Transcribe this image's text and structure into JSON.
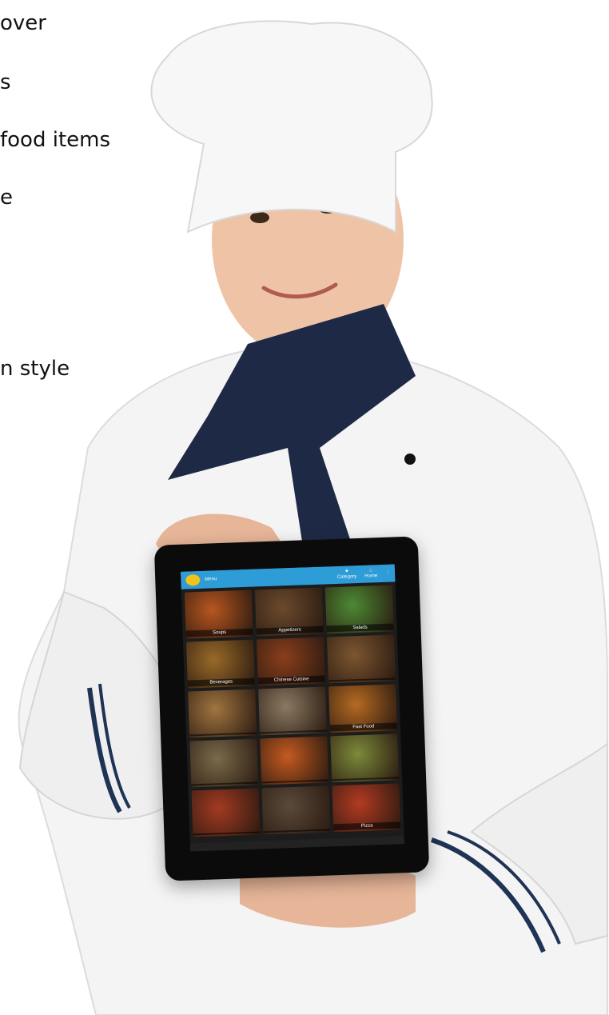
{
  "slide_text": {
    "line1": "over",
    "line2": "s",
    "line3": "food items",
    "line4": "e",
    "line5": "n style"
  },
  "app": {
    "title": "Menu",
    "action_1": "Category",
    "action_2": "Home",
    "footer_left": "",
    "footer_right": ""
  },
  "menu_tiles": [
    {
      "label": "Soups",
      "color": "#b8561f"
    },
    {
      "label": "Appetizers",
      "color": "#6b4a2d"
    },
    {
      "label": "Salads",
      "color": "#4d8a34"
    },
    {
      "label": "Beverages",
      "color": "#9a6a28"
    },
    {
      "label": "Chinese Cuisine",
      "color": "#8a3e1c"
    },
    {
      "label": "",
      "color": "#7c5630"
    },
    {
      "label": "",
      "color": "#a07540"
    },
    {
      "label": "",
      "color": "#8a7a62"
    },
    {
      "label": "Fast Food",
      "color": "#b66a22"
    },
    {
      "label": "",
      "color": "#7a6a4a"
    },
    {
      "label": "",
      "color": "#c45a20"
    },
    {
      "label": "",
      "color": "#7d8a3a"
    },
    {
      "label": "",
      "color": "#a33a22"
    },
    {
      "label": "",
      "color": "#5a4a3a"
    },
    {
      "label": "Pizza",
      "color": "#b33a22"
    }
  ]
}
